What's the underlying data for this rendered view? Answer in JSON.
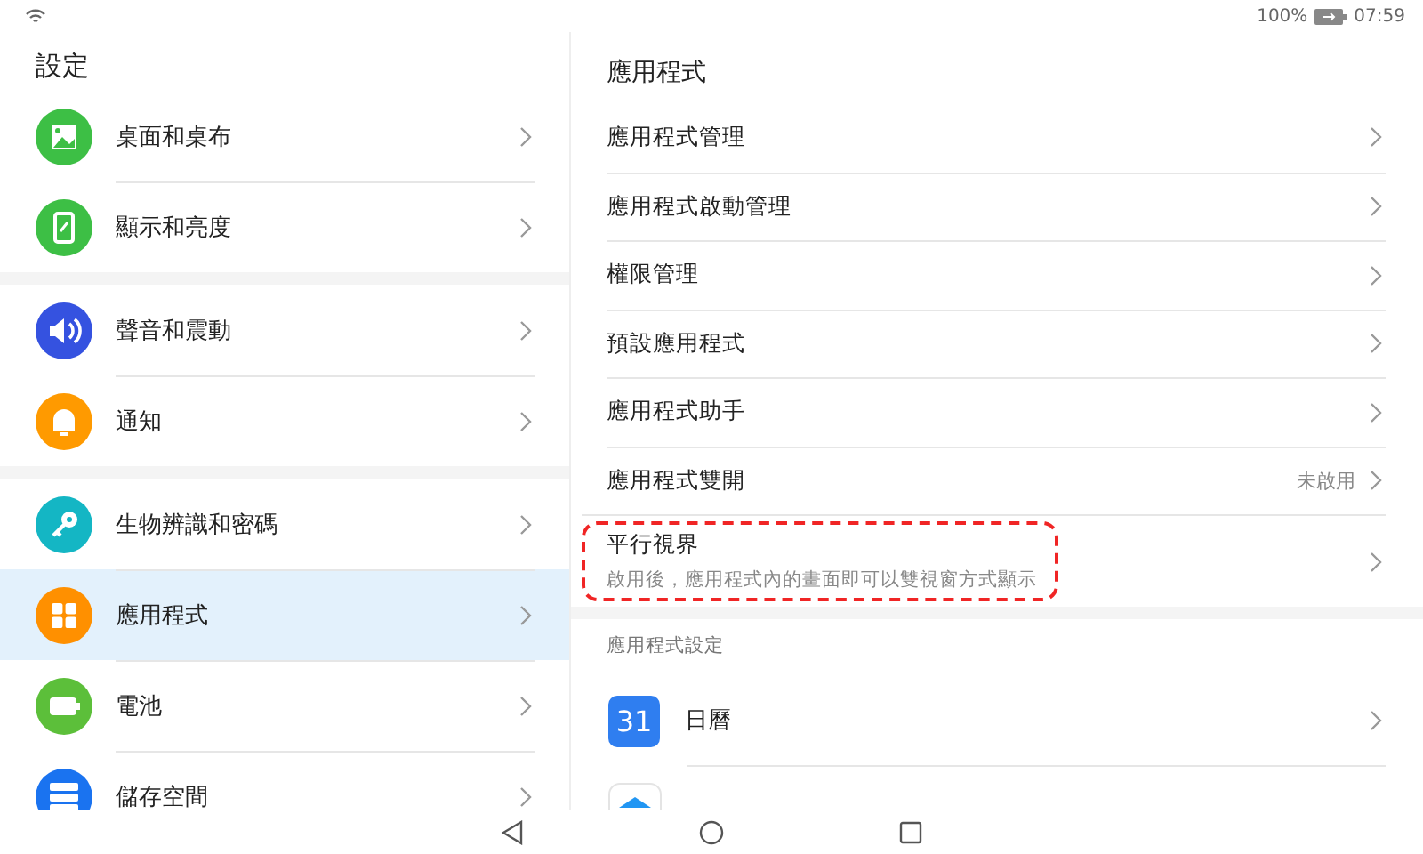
{
  "status_bar": {
    "battery": "100%",
    "time": "07:59"
  },
  "sidebar": {
    "title": "設定",
    "groups": [
      [
        {
          "label": "桌面和桌布",
          "color": "#3dbf45",
          "selected": false
        },
        {
          "label": "顯示和亮度",
          "color": "#3dbf45",
          "selected": false
        }
      ],
      [
        {
          "label": "聲音和震動",
          "color": "#3552e0",
          "selected": false
        },
        {
          "label": "通知",
          "color": "#ff9a00",
          "selected": false
        }
      ],
      [
        {
          "label": "生物辨識和密碼",
          "color": "#14b6c4",
          "selected": false
        },
        {
          "label": "應用程式",
          "color": "#ff9000",
          "selected": true
        },
        {
          "label": "電池",
          "color": "#5cbf3a",
          "selected": false
        },
        {
          "label": "儲存空間",
          "color": "#1a73f0",
          "selected": false
        }
      ]
    ]
  },
  "detail": {
    "title": "應用程式",
    "rows": [
      {
        "label": "應用程式管理"
      },
      {
        "label": "應用程式啟動管理"
      },
      {
        "label": "權限管理"
      },
      {
        "label": "預設應用程式"
      },
      {
        "label": "應用程式助手"
      },
      {
        "label": "應用程式雙開",
        "value": "未啟用"
      },
      {
        "label": "平行視界",
        "description": "啟用後，應用程式內的畫面即可以雙視窗方式顯示",
        "highlighted": true
      }
    ],
    "section_label": "應用程式設定",
    "apps": [
      {
        "label": "日曆",
        "icon_text": "31"
      },
      {
        "kind": "app"
      }
    ]
  }
}
